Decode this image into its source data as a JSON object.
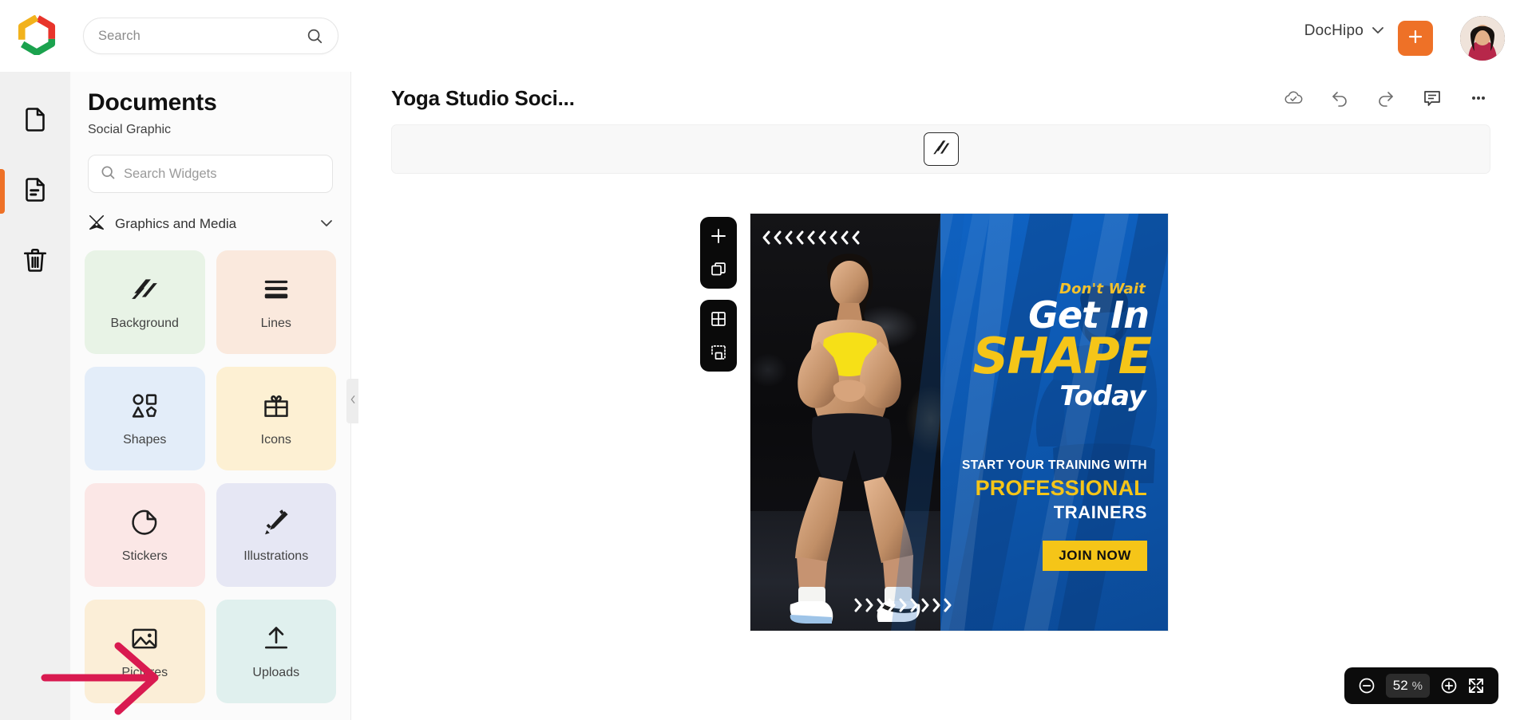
{
  "topbar": {
    "logo_icon": "dochipo-logo-icon",
    "search": {
      "placeholder": "Search",
      "value": "",
      "icon": "search-icon"
    },
    "org_label": "DocHipo",
    "org_chevron_icon": "chevron-down-icon",
    "create_button_icon": "plus-icon",
    "avatar_label": "user-avatar",
    "accent_orange": "#ee7127"
  },
  "rail": {
    "items": [
      {
        "name": "new-document",
        "icon": "document-blank-icon",
        "active": false
      },
      {
        "name": "my-documents",
        "icon": "document-lines-icon",
        "active": true
      },
      {
        "name": "trash",
        "icon": "trash-icon",
        "active": false
      }
    ]
  },
  "panel": {
    "title": "Documents",
    "subtitle": "Social Graphic",
    "search": {
      "placeholder": "Search Widgets",
      "value": "",
      "icon": "search-icon"
    },
    "section": {
      "label": "Graphics and Media",
      "icon": "graphics-media-icon",
      "chevron_icon": "chevron-down-icon",
      "expanded": true
    },
    "tiles": [
      {
        "label": "Background",
        "icon": "background-stripes-icon",
        "bg": "#e8f3e6"
      },
      {
        "label": "Lines",
        "icon": "lines-icon",
        "bg": "#fae9dd"
      },
      {
        "label": "Shapes",
        "icon": "shapes-icon",
        "bg": "#e3edf9"
      },
      {
        "label": "Icons",
        "icon": "gift-icon",
        "bg": "#fdf0d3"
      },
      {
        "label": "Stickers",
        "icon": "sticker-icon",
        "bg": "#fbe7e6"
      },
      {
        "label": "Illustrations",
        "icon": "pencil-sparkle-icon",
        "bg": "#e6e7f4"
      },
      {
        "label": "Pictures",
        "icon": "image-icon",
        "bg": "#fbeed7"
      },
      {
        "label": "Uploads",
        "icon": "upload-arrow-icon",
        "bg": "#e0f0ee"
      }
    ],
    "collapse_icon": "chevron-left-icon"
  },
  "annotation": {
    "arrow": "red-arrow-pointing-to-pictures",
    "color": "#d91a50"
  },
  "canvas": {
    "doc_title": "Yoga Studio Soci...",
    "actions": [
      {
        "name": "save-status",
        "icon": "cloud-check-icon"
      },
      {
        "name": "undo",
        "icon": "undo-arrow-icon"
      },
      {
        "name": "redo",
        "icon": "redo-arrow-icon"
      },
      {
        "name": "comments",
        "icon": "comment-bubble-icon"
      },
      {
        "name": "more-options",
        "icon": "ellipsis-icon"
      }
    ],
    "tool_strip": {
      "button_icon": "background-stripes-icon",
      "button_name": "background-widget-button"
    },
    "page_tools": [
      {
        "name": "add-page",
        "icon": "plus-icon"
      },
      {
        "name": "duplicate-page",
        "icon": "duplicate-icon"
      },
      {
        "name": "grid-view",
        "icon": "grid-icon"
      },
      {
        "name": "select-area",
        "icon": "crop-select-icon"
      }
    ],
    "zoom": {
      "out_icon": "zoom-out-icon",
      "in_icon": "zoom-in-icon",
      "fit_icon": "fullscreen-icon",
      "value": "52",
      "unit": "%"
    }
  },
  "artboard": {
    "chevrons_top": "<<<<<<<<<",
    "chevrons_bottom": ">>>>>>>>>",
    "eyebrow": "Don't Wait",
    "headline_1": "Get In",
    "headline_2": "SHAPE",
    "headline_3": "Today",
    "sub_1": "START YOUR TRAINING WITH",
    "sub_2": "PROFESSIONAL",
    "sub_3": "TRAINERS",
    "cta": "JOIN NOW",
    "colors": {
      "blue": "#0d58b0",
      "yellow": "#f5c518",
      "white": "#ffffff"
    }
  }
}
